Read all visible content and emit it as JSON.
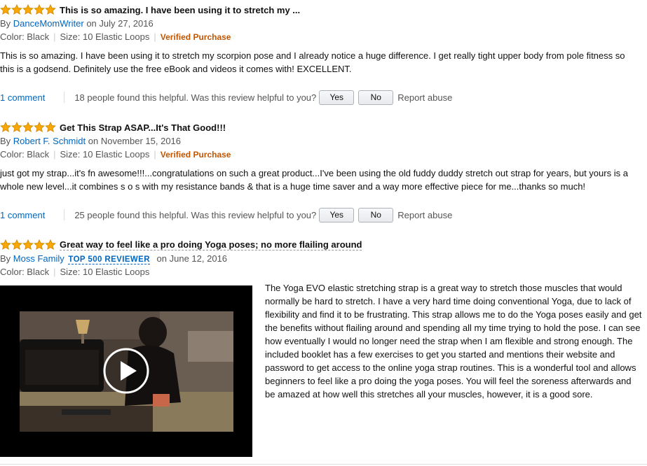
{
  "reviews": [
    {
      "title": "This is so amazing. I have been using it to stretch my ...",
      "by": "By",
      "author": "DanceMomWriter",
      "date": "on July 27, 2016",
      "color": "Color: Black",
      "size": "Size: 10 Elastic Loops",
      "verified": "Verified Purchase",
      "body": "This is so amazing. I have been using it to stretch my scorpion pose and I already notice a huge difference. I get really tight upper body from pole fitness so this is a godsend. Definitely use the free eBook and videos it comes with! EXCELLENT.",
      "comments": "1 comment",
      "helpful": "18 people found this helpful. Was this review helpful to you?",
      "yes": "Yes",
      "no": "No",
      "report": "Report abuse",
      "rating": 5
    },
    {
      "title": "Get This Strap ASAP...It's That Good!!!",
      "by": "By",
      "author": "Robert F. Schmidt",
      "date": "on November 15, 2016",
      "color": "Color: Black",
      "size": "Size: 10 Elastic Loops",
      "verified": "Verified Purchase",
      "body": "just got my strap...it's fn awesome!!!...congratulations on such a great product...I've been using the old fuddy duddy stretch out strap for years, but yours is a whole new level...it combines s o s with my resistance bands & that is a huge time saver and a way more effective piece for me...thanks so much!",
      "comments": "1 comment",
      "helpful": "25 people found this helpful. Was this review helpful to you?",
      "yes": "Yes",
      "no": "No",
      "report": "Report abuse",
      "rating": 5
    },
    {
      "title": "Great way to feel like a pro doing Yoga poses; no more flailing around",
      "by": "By",
      "author": "Moss Family",
      "badge": "TOP 500 REVIEWER",
      "date": "on June 12, 2016",
      "color": "Color: Black",
      "size": "Size: 10 Elastic Loops",
      "body": "The Yoga EVO elastic stretching strap is a great way to stretch those muscles that would normally be hard to stretch. I have a very hard time doing conventional Yoga, due to lack of flexibility and find it to be frustrating. This strap allows me to do the Yoga poses easily and get the benefits without flailing around and spending all my time trying to hold the pose. I can see how eventually I would no longer need the strap when I am flexible and strong enough. The included booklet has a few exercises to get you started and mentions their website and password to get access to the online yoga strap routines. This is a wonderful tool and allows beginners to feel like a pro doing the yoga poses. You will feel the soreness afterwards and be amazed at how well this stretches all your muscles, however, it is a good sore.",
      "rating": 5
    }
  ],
  "colors": {
    "star": "#f7a700",
    "link": "#0066c0",
    "verified": "#c45500"
  },
  "icons": {
    "star": "star-icon",
    "play": "play-icon"
  }
}
